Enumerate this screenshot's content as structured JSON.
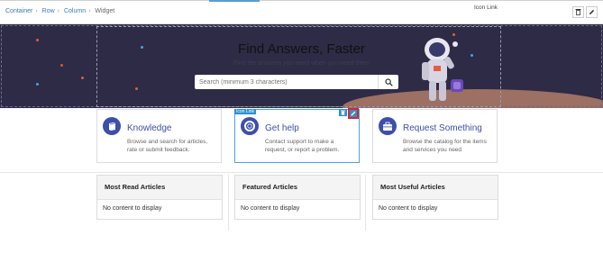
{
  "breadcrumb": {
    "items": [
      "Container",
      "Row",
      "Column",
      "Widget"
    ],
    "separator": "›"
  },
  "toolbar": {
    "icon_link_label": "Icon Link",
    "delete_icon": "trash-icon",
    "edit_icon": "pencil-icon"
  },
  "hero": {
    "title": "Find Answers, Faster",
    "subtitle": "Find the answers you need when you need them",
    "search_placeholder": "Search (minimum 3 characters)"
  },
  "cards": [
    {
      "title": "Knowledge",
      "description": "Browse and search for articles, rate or submit feedback.",
      "icon": "book-icon"
    },
    {
      "title": "Get help",
      "description": "Contact support to make a request, or report a problem.",
      "icon": "lifebuoy-icon"
    },
    {
      "title": "Request Something",
      "description": "Browse the catalog for the items and services you need",
      "icon": "briefcase-icon"
    }
  ],
  "selection": {
    "tag": "Icon Link"
  },
  "panels": [
    {
      "title": "Most Read Articles",
      "body": "No content to display"
    },
    {
      "title": "Featured Articles",
      "body": "No content to display"
    },
    {
      "title": "Most Useful Articles",
      "body": "No content to display"
    }
  ],
  "colors": {
    "hero_bg": "#2d2b45",
    "accent": "#3c4faa",
    "selection": "#2f8fd6",
    "highlight": "#d9262c"
  }
}
